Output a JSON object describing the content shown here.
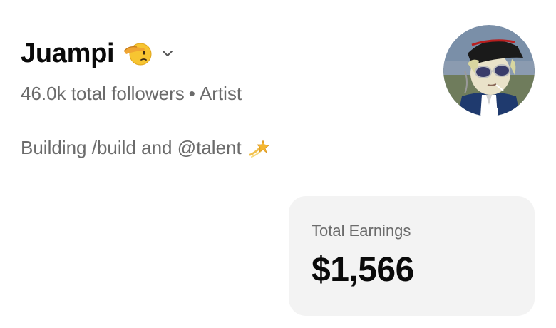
{
  "profile": {
    "name": "Juampi",
    "name_emoji": "salute-face-emoji",
    "followers_text": "46.0k total followers",
    "separator": "•",
    "role": "Artist",
    "bio": "Building /build and @talent",
    "bio_emoji": "dizzy-emoji"
  },
  "earnings": {
    "label": "Total Earnings",
    "value": "$1,566"
  },
  "colors": {
    "text_primary": "#0a0a0a",
    "text_secondary": "#6b6b6b",
    "card_background": "#f3f3f3"
  }
}
